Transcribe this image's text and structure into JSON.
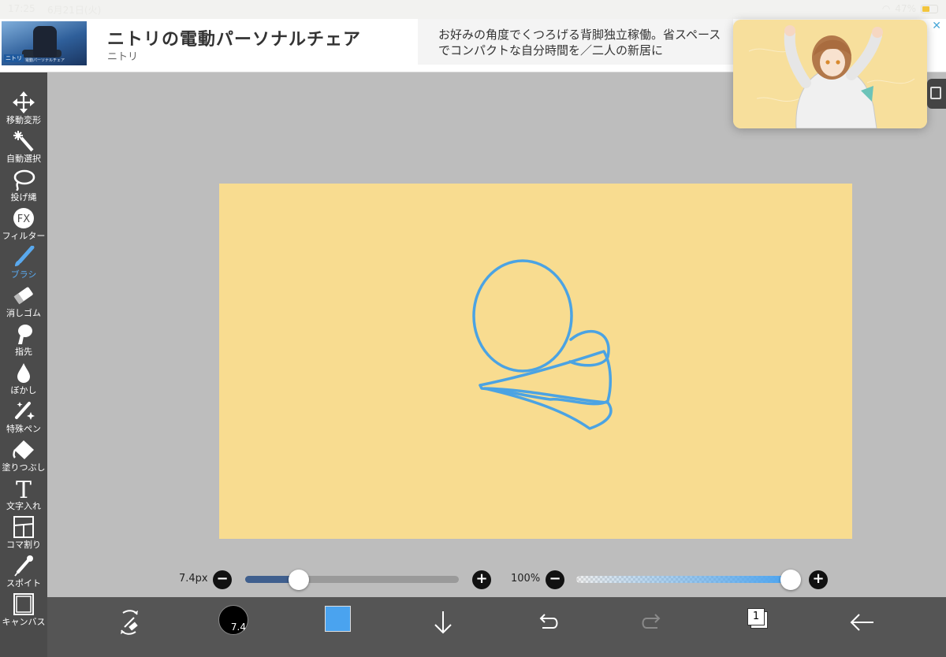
{
  "status": {
    "time": "17:25",
    "date": "6月21日(火)",
    "battery_text": "47%"
  },
  "ad": {
    "thumb_brand": "ニトリ",
    "thumb_caption": "電動パーソナルチェア",
    "title": "ニトリの電動パーソナルチェア",
    "sponsor": "ニトリ",
    "description_line1": "お好みの角度でくつろげる背脚独立稼働。省スペース",
    "description_line2": "でコンパクトな自分時間を／二人の新居に",
    "info_icon": "info-icon",
    "close_icon": "close-icon"
  },
  "tools": [
    {
      "label": "移動変形",
      "icon": "move-icon"
    },
    {
      "label": "自動選択",
      "icon": "magic-wand-icon"
    },
    {
      "label": "投げ縄",
      "icon": "lasso-icon"
    },
    {
      "label": "フィルター",
      "icon": "fx-icon"
    },
    {
      "label": "ブラシ",
      "icon": "brush-icon",
      "active": true
    },
    {
      "label": "消しゴム",
      "icon": "eraser-icon"
    },
    {
      "label": "指先",
      "icon": "smudge-icon"
    },
    {
      "label": "ぼかし",
      "icon": "blur-drop-icon"
    },
    {
      "label": "特殊ペン",
      "icon": "special-pen-icon"
    },
    {
      "label": "塗りつぶし",
      "icon": "bucket-icon"
    },
    {
      "label": "文字入れ",
      "icon": "text-icon"
    },
    {
      "label": "コマ割り",
      "icon": "frame-icon"
    },
    {
      "label": "スポイト",
      "icon": "eyedropper-icon"
    },
    {
      "label": "キャンバス",
      "icon": "canvas-icon"
    }
  ],
  "fx_glyph": "FX",
  "text_glyph": "T",
  "sliders": {
    "size_value": "7.4px",
    "size_fraction": 0.25,
    "opacity_value": "100%",
    "opacity_fraction": 1.0,
    "minus": "−",
    "plus": "+"
  },
  "bottombar": {
    "brush_size_label": "7.4",
    "color": "#4aa3ef",
    "layer_count": "1"
  },
  "colors": {
    "canvas": "#f8dc90",
    "stroke": "#4ba3e3",
    "accent": "#5aa9ee",
    "toolbar": "#4b4b4b"
  }
}
